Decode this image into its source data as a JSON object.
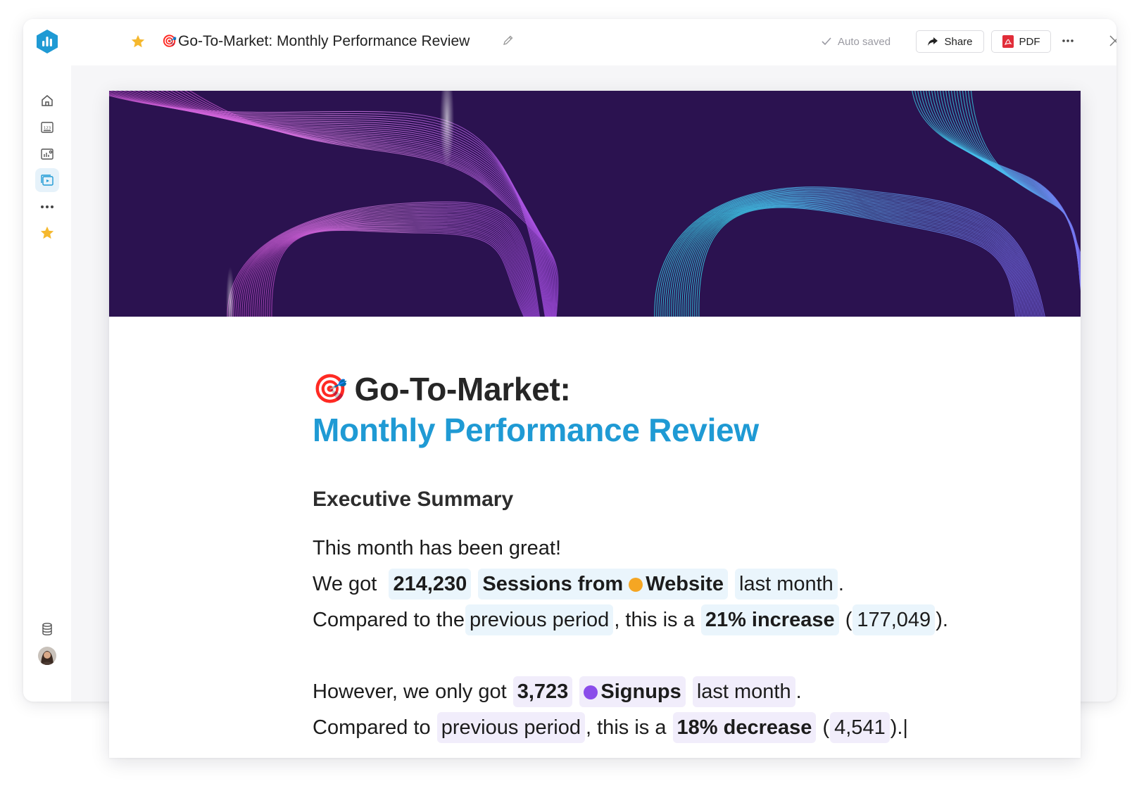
{
  "topbar": {
    "doc_emoji": "🎯",
    "doc_title": "Go-To-Market: Monthly Performance Review",
    "autosave_label": "Auto saved",
    "share_label": "Share",
    "pdf_label": "PDF"
  },
  "sidebar": {
    "items": [
      {
        "icon": "home-icon"
      },
      {
        "icon": "metrics-icon"
      },
      {
        "icon": "dashboards-icon"
      },
      {
        "icon": "reports-icon",
        "active": true
      },
      {
        "icon": "more-icon"
      },
      {
        "icon": "favorites-star-icon"
      }
    ],
    "bottom": [
      {
        "icon": "data-stack-icon"
      },
      {
        "icon": "avatar"
      }
    ]
  },
  "colors": {
    "accent": "#1f9ad4",
    "hero_bg": "#2b1250",
    "pill_blue": "#eaf5fc",
    "pill_purple": "#f1edfb",
    "star": "#f5b82e",
    "pdf_red": "#e12d39"
  },
  "document": {
    "title_emoji": "🎯",
    "title_line1": "Go-To-Market:",
    "title_line2": "Monthly Performance Review",
    "section_heading": "Executive Summary",
    "para1": "This month has been great!",
    "line2": {
      "prefix": "We got",
      "value": "214,230",
      "metric": "Sessions from",
      "source": "Website",
      "period": "last month",
      "suffix": "."
    },
    "line3": {
      "prefix": "Compared to the",
      "comparison": "previous period",
      "middle": ", this is a",
      "change": "21% increase",
      "open": "(",
      "previous_value": "177,049",
      "close": ")."
    },
    "line4": {
      "prefix": "However, we only got",
      "value": "3,723",
      "metric": "Signups",
      "period": "last month",
      "suffix": "."
    },
    "line5": {
      "prefix": "Compared to",
      "comparison": "previous period",
      "middle": ", this is a",
      "change": "18% decrease",
      "open": "(",
      "previous_value": "4,541",
      "close": ").",
      "caret": "|"
    }
  }
}
